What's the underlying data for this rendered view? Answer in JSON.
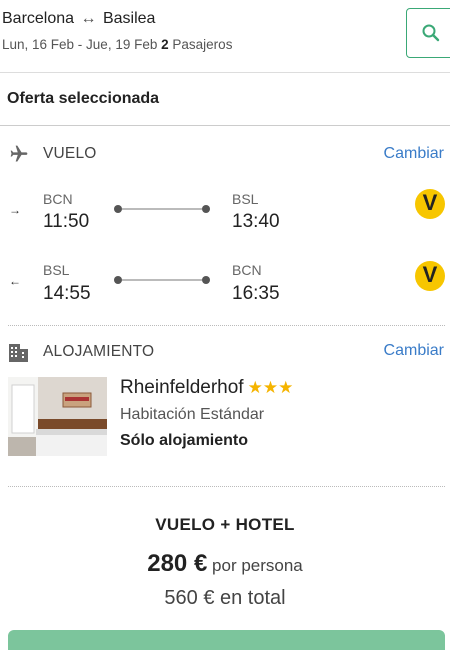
{
  "header": {
    "origin": "Barcelona",
    "route_arrow": "↔",
    "destination": "Basilea",
    "dates": "Lun, 16 Feb - Jue, 19 Feb",
    "passengers_count": "2",
    "passengers_label": "Pasajeros",
    "search_icon": "search-icon"
  },
  "offer": {
    "title": "Oferta seleccionada"
  },
  "flight": {
    "label": "VUELO",
    "change_label": "Cambiar",
    "icon": "plane-icon",
    "outbound": {
      "direction": "→",
      "from_code": "BCN",
      "from_time": "11:50",
      "to_code": "BSL",
      "to_time": "13:40",
      "airline_logo": "V"
    },
    "return": {
      "direction": "←",
      "from_code": "BSL",
      "from_time": "14:55",
      "to_code": "BCN",
      "to_time": "16:35",
      "airline_logo": "V"
    }
  },
  "accommodation": {
    "label": "ALOJAMIENTO",
    "change_label": "Cambiar",
    "icon": "building-icon",
    "hotel_name": "Rheinfelderhof",
    "stars": "★★★",
    "room_type": "Habitación Estándar",
    "board": "Sólo alojamiento"
  },
  "package": {
    "title": "VUELO + HOTEL",
    "price_amount": "280 €",
    "price_per": "por persona",
    "total": "560 € en total"
  },
  "colors": {
    "accent_green": "#3aa876",
    "link_blue": "#3a7cc8",
    "star_gold": "#f5b400",
    "airline_yellow": "#f7c600"
  }
}
